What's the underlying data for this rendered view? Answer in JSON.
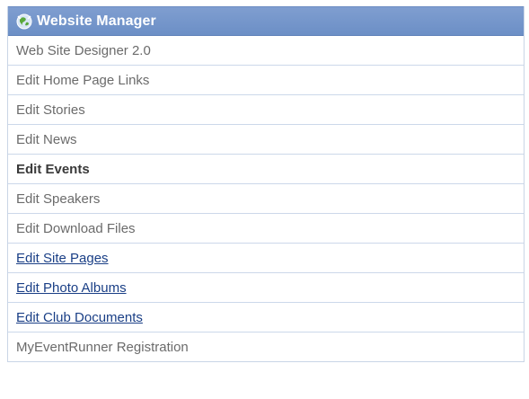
{
  "panel": {
    "title": "Website Manager",
    "icon": "globe-icon",
    "items": [
      {
        "label": "Web Site Designer 2.0",
        "style": "plain"
      },
      {
        "label": "Edit Home Page Links",
        "style": "plain"
      },
      {
        "label": "Edit Stories",
        "style": "plain"
      },
      {
        "label": "Edit News",
        "style": "plain"
      },
      {
        "label": "Edit Events",
        "style": "bold"
      },
      {
        "label": "Edit Speakers",
        "style": "plain"
      },
      {
        "label": "Edit Download Files",
        "style": "plain"
      },
      {
        "label": "Edit Site Pages",
        "style": "link"
      },
      {
        "label": "Edit Photo Albums",
        "style": "link"
      },
      {
        "label": "Edit Club Documents",
        "style": "link"
      },
      {
        "label": "MyEventRunner Registration",
        "style": "plain"
      }
    ]
  },
  "colors": {
    "header": "#6c8fc6",
    "link": "#1a3f86",
    "plain_text": "#6b6b6b",
    "divider": "#ccd8ea"
  }
}
